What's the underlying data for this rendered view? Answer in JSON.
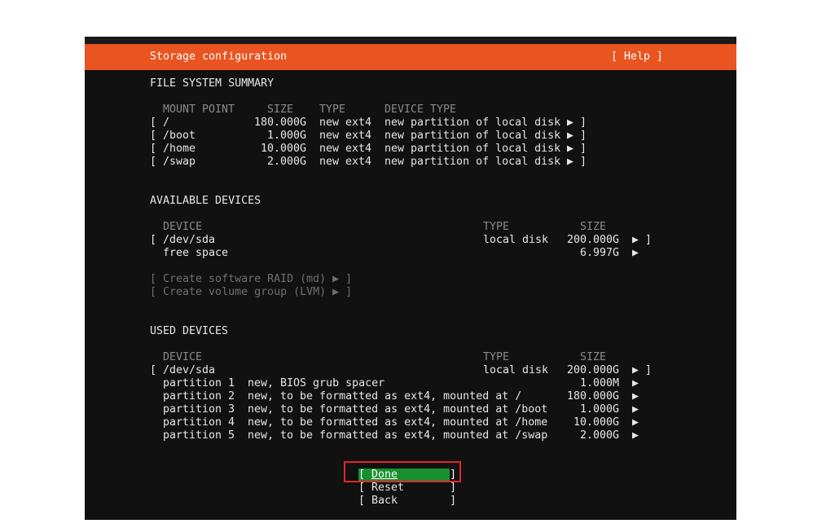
{
  "header": {
    "title": "Storage configuration",
    "help": "[ Help ]"
  },
  "fs_summary": {
    "heading": "FILE SYSTEM SUMMARY",
    "columns": [
      "MOUNT POINT",
      "SIZE",
      "TYPE",
      "DEVICE TYPE"
    ],
    "rows": [
      {
        "mount": "/",
        "size": "180.000G",
        "type": "new ext4",
        "device_type": "new partition of local disk"
      },
      {
        "mount": "/boot",
        "size": "1.000G",
        "type": "new ext4",
        "device_type": "new partition of local disk"
      },
      {
        "mount": "/home",
        "size": "10.000G",
        "type": "new ext4",
        "device_type": "new partition of local disk"
      },
      {
        "mount": "/swap",
        "size": "2.000G",
        "type": "new ext4",
        "device_type": "new partition of local disk"
      }
    ]
  },
  "available": {
    "heading": "AVAILABLE DEVICES",
    "columns": [
      "DEVICE",
      "TYPE",
      "SIZE"
    ],
    "device": {
      "name": "/dev/sda",
      "type": "local disk",
      "size": "200.000G"
    },
    "free": {
      "name": "free space",
      "size": "6.997G"
    },
    "actions": [
      "Create software RAID (md)",
      "Create volume group (LVM)"
    ]
  },
  "used": {
    "heading": "USED DEVICES",
    "columns": [
      "DEVICE",
      "TYPE",
      "SIZE"
    ],
    "device": {
      "name": "/dev/sda",
      "type": "local disk",
      "size": "200.000G"
    },
    "partitions": [
      {
        "name": "partition 1",
        "desc": "new, BIOS grub spacer",
        "size": "1.000M"
      },
      {
        "name": "partition 2",
        "desc": "new, to be formatted as ext4, mounted at /",
        "size": "180.000G"
      },
      {
        "name": "partition 3",
        "desc": "new, to be formatted as ext4, mounted at /boot",
        "size": "1.000G"
      },
      {
        "name": "partition 4",
        "desc": "new, to be formatted as ext4, mounted at /home",
        "size": "10.000G"
      },
      {
        "name": "partition 5",
        "desc": "new, to be formatted as ext4, mounted at /swap",
        "size": "2.000G"
      }
    ]
  },
  "buttons": {
    "done": "Done",
    "reset": "Reset",
    "back": "Back"
  },
  "colors": {
    "header_bg": "#e95420",
    "done_bg": "#1a8f2e",
    "highlight_outline": "#e0262d",
    "screen_bg": "#111111"
  },
  "icons": {
    "expand": "right-triangle-icon"
  }
}
